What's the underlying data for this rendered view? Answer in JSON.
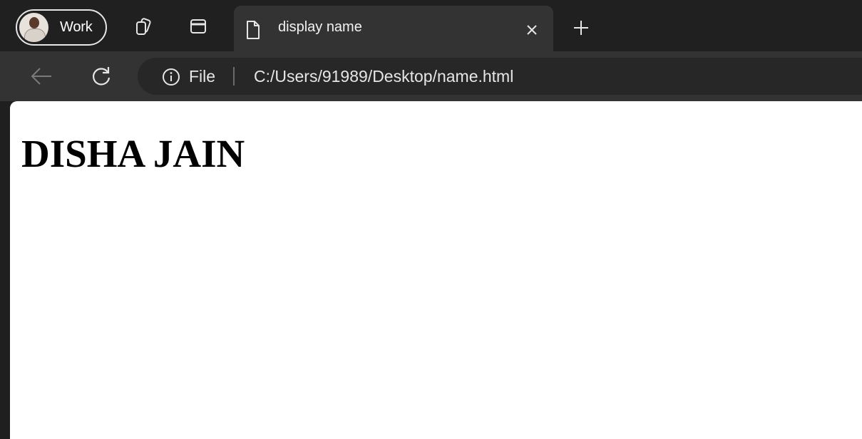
{
  "browser": {
    "profile": {
      "label": "Work",
      "avatar_icon": "user-avatar-icon"
    },
    "tab_strip": {
      "workspaces_icon": "workspaces-icon",
      "vertical_tabs_icon": "tab-actions-icon",
      "active_tab": {
        "title": "display name",
        "icon": "page-icon",
        "close_icon": "close-icon"
      },
      "new_tab_icon": "plus-icon"
    },
    "toolbar": {
      "back_icon": "back-arrow-icon",
      "refresh_icon": "refresh-icon",
      "address": {
        "info_icon": "info-icon",
        "scheme_label": "File",
        "url": "C:/Users/91989/Desktop/name.html"
      }
    },
    "colors": {
      "tab_strip_bg": "#202020",
      "toolbar_bg": "#333333",
      "address_bg": "#272727",
      "page_bg": "#ffffff"
    }
  },
  "page": {
    "heading": "DISHA JAIN"
  }
}
